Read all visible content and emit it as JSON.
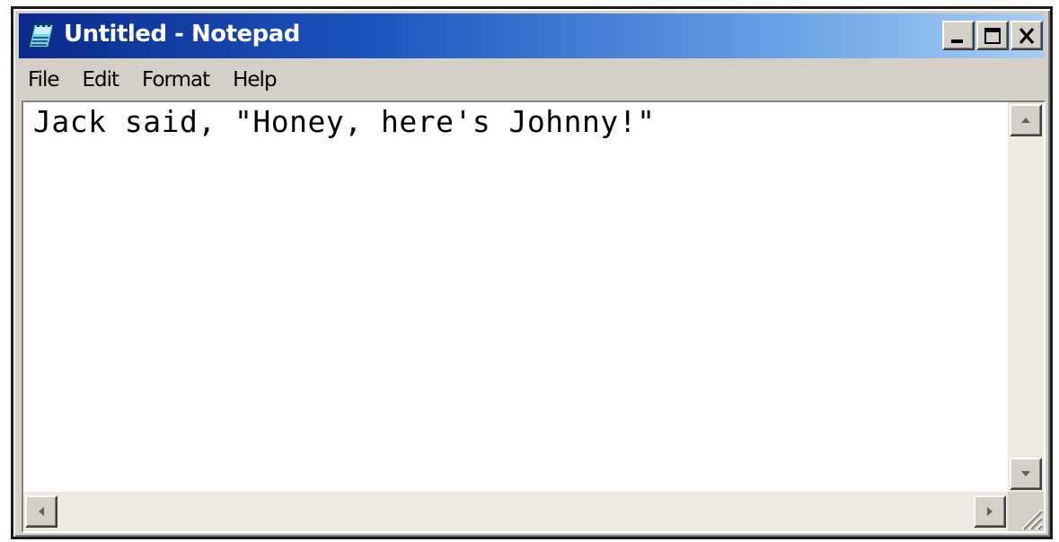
{
  "window": {
    "title": "Untitled - Notepad",
    "app_icon": "notepad-icon",
    "controls": {
      "minimize_icon": "minimize-icon",
      "maximize_icon": "maximize-icon",
      "close_icon": "close-icon"
    }
  },
  "menu": {
    "items": [
      {
        "label": "File"
      },
      {
        "label": "Edit"
      },
      {
        "label": "Format"
      },
      {
        "label": "Help"
      }
    ]
  },
  "editor": {
    "content": "Jack said, \"Honey, here's Johnny!\""
  },
  "colors": {
    "title_gradient_start": "#0a2a8c",
    "title_gradient_end": "#a9cdf3",
    "chrome": "#d4d0c8",
    "text": "#000000"
  }
}
